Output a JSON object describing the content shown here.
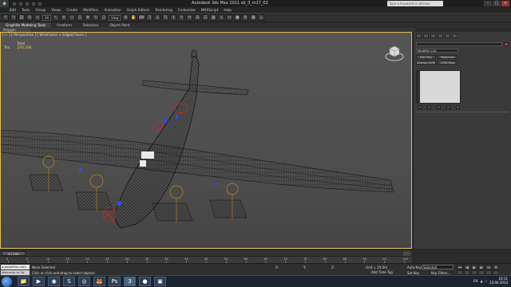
{
  "window": {
    "title": "Autodesk 3ds Max 2011     sb_3_m17_02",
    "search_placeholder": "Type a keyword or phrase"
  },
  "menu": [
    "Edit",
    "Tools",
    "Group",
    "Views",
    "Create",
    "Modifiers",
    "Animation",
    "Graph Editors",
    "Rendering",
    "Customize",
    "MAXScript",
    "Help"
  ],
  "toolbar": {
    "filter_value": "All",
    "view_value": "View"
  },
  "ribbon": {
    "tabs": [
      "Graphite Modeling Tools",
      "Freeform",
      "Selection",
      "Object Paint"
    ],
    "sub_label": "Polygon Modeling"
  },
  "viewport": {
    "label": "[ + ] [ Perspective ] [ Wireframe + Edged Faces ]",
    "stats_total_label": "Total",
    "stats_tris_label": "Tris",
    "stats_tris_value": "270,336"
  },
  "command_panel": {
    "modifier_list": "Modifier List",
    "btn_edit_poly": "Edit Poly",
    "btn_projection": "Projection",
    "btn_unwrap": "Unwrap UVW",
    "btn_uvw_map": "UVW Map"
  },
  "timeline": {
    "slider_text": "0 / 100",
    "ticks": [
      "0",
      "5",
      "10",
      "15",
      "20",
      "25",
      "30",
      "35",
      "40",
      "45",
      "50",
      "55",
      "60",
      "65",
      "70",
      "75",
      "80",
      "85",
      "90",
      "95",
      "100"
    ]
  },
  "status": {
    "maxscript_label": "autodeMax.max",
    "welcome": "Welcome to 3d",
    "selection": "None Selected",
    "hint": "Click or click-and-drag to select objects",
    "x_label": "X:",
    "y_label": "Y:",
    "z_label": "Z:",
    "grid": "Grid = 10.0m",
    "add_time_tag": "Add Time Tag",
    "auto_key": "Auto Key",
    "selected_value": "Selected",
    "set_key": "Set Key",
    "key_filters": "Key Filters..."
  },
  "taskbar": {
    "lang": "EN",
    "time": "23:11",
    "date": "23.04.2014"
  },
  "colors": {
    "viewport_border": "#e8c04a",
    "stats_text": "#ffd66a",
    "wireframe": "#111111",
    "selected_red": "#e02020",
    "blue_parts": "#2a4cff",
    "prop_orange": "#c58a1a"
  }
}
